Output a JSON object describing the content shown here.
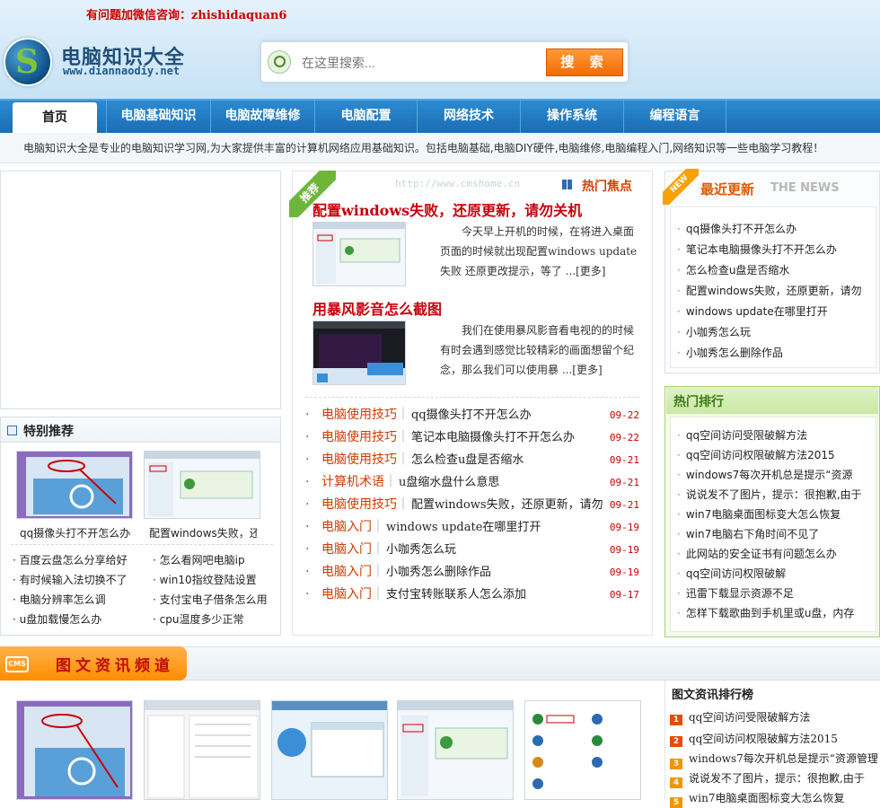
{
  "top_notice": "有问题加微信咨询：zhishidaquan6",
  "header": {
    "site_name": "电脑知识大全",
    "site_url": "www.diannaodiy.net",
    "search_placeholder": "在这里搜索...",
    "search_button": "搜 索"
  },
  "nav": {
    "items": [
      "首页",
      "电脑基础知识",
      "电脑故障维修",
      "电脑配置",
      "网络技术",
      "操作系统",
      "编程语言"
    ]
  },
  "intro": "电脑知识大全是专业的电脑知识学习网,为大家提供丰富的计算机网络应用基础知识。包括电脑基础,电脑DIY硬件,电脑维修,电脑编程入门,网络知识等一些电脑学习教程！",
  "special": {
    "title": "特别推荐",
    "thumbs": [
      "qq摄像头打不开怎么办",
      "配置windows失败，还"
    ],
    "links": [
      "百度云盘怎么分享给好",
      "怎么看网吧电脑ip",
      "有时候输入法切换不了",
      "win10指纹登陆设置",
      "电脑分辨率怎么调",
      "支付宝电子借条怎么用",
      "u盘加载慢怎么办",
      "cpu温度多少正常"
    ]
  },
  "center": {
    "badge": "推荐",
    "hot_focus": "热门焦点",
    "watermark": "http://www.cmshome.cn",
    "features": [
      {
        "title": "配置windows失败，还原更新，请勿关机",
        "desc": "今天早上开机的时候，在将进入桌面页面的时候就出现配置windows update失败 还原更改提示，等了 ...[更多]"
      },
      {
        "title": "用暴风影音怎么截图",
        "desc": "我们在使用暴风影音看电视的的时候有时会遇到感觉比较精彩的画面想留个纪念，那么我们可以使用暴 ...[更多]"
      }
    ],
    "list": [
      {
        "cat": "电脑使用技巧",
        "title": "qq摄像头打不开怎么办",
        "date": "09-22"
      },
      {
        "cat": "电脑使用技巧",
        "title": "笔记本电脑摄像头打不开怎么办",
        "date": "09-22"
      },
      {
        "cat": "电脑使用技巧",
        "title": "怎么检查u盘是否缩水",
        "date": "09-21"
      },
      {
        "cat": "计算机术语",
        "title": "u盘缩水盘什么意思",
        "date": "09-21"
      },
      {
        "cat": "电脑使用技巧",
        "title": "配置windows失败，还原更新，请勿",
        "date": "09-21"
      },
      {
        "cat": "电脑入门",
        "title": "windows update在哪里打开",
        "date": "09-19"
      },
      {
        "cat": "电脑入门",
        "title": "小咖秀怎么玩",
        "date": "09-19"
      },
      {
        "cat": "电脑入门",
        "title": "小咖秀怎么删除作品",
        "date": "09-19"
      },
      {
        "cat": "电脑入门",
        "title": "支付宝转账联系人怎么添加",
        "date": "09-17"
      }
    ]
  },
  "recent": {
    "badge": "NEW",
    "title": "最近更新",
    "subtitle": "THE NEWS",
    "items": [
      "qq摄像头打不开怎么办",
      "笔记本电脑摄像头打不开怎么办",
      "怎么检查u盘是否缩水",
      "配置windows失败，还原更新，请勿",
      "windows update在哪里打开",
      "小咖秀怎么玩",
      "小咖秀怎么删除作品"
    ]
  },
  "hotrank": {
    "title": "热门排行",
    "items": [
      "qq空间访问受限破解方法",
      "qq空间访问权限破解方法2015",
      "windows7每次开机总是提示“资源",
      "说说发不了图片，提示：很抱歉,由于",
      "win7电脑桌面图标变大怎么恢复",
      "win7电脑右下角时间不见了",
      "此网站的安全证书有问题怎么办",
      "qq空间访问权限破解",
      "迅雷下载显示资源不足",
      "怎样下载歌曲到手机里或u盘，内存"
    ]
  },
  "cms": {
    "badge": "CMS",
    "title": "图文资讯频道",
    "rank_title": "图文资讯排行榜",
    "rank": [
      {
        "n": "1",
        "t": "qq空间访问受限破解方法"
      },
      {
        "n": "2",
        "t": "qq空间访问权限破解方法2015"
      },
      {
        "n": "3",
        "t": "windows7每次开机总是提示“资源管理"
      },
      {
        "n": "4",
        "t": "说说发不了图片，提示：很抱歉,由于"
      },
      {
        "n": "5",
        "t": "win7电脑桌面图标变大怎么恢复"
      }
    ]
  },
  "colors": {
    "accent_blue": "#1b6db4",
    "accent_orange": "#f26c05",
    "link_red": "#c7000b",
    "hot_green": "#a8d178"
  }
}
